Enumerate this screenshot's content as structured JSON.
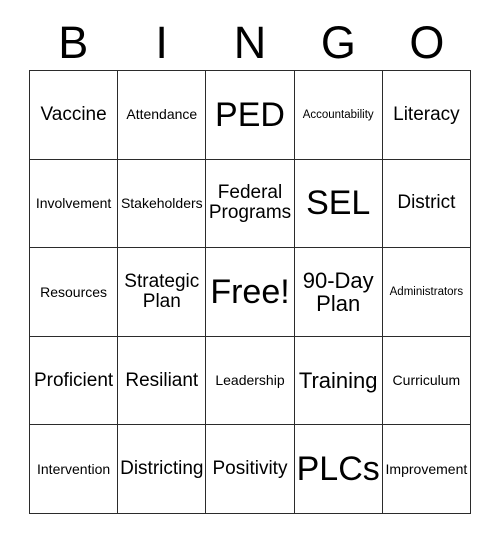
{
  "card": {
    "header_letters": [
      "B",
      "I",
      "N",
      "G",
      "O"
    ],
    "free_space_label": "Free!",
    "rows": [
      [
        {
          "label": "Vaccine",
          "size": "md"
        },
        {
          "label": "Attendance",
          "size": "sm"
        },
        {
          "label": "PED",
          "size": "xxl"
        },
        {
          "label": "Accountability",
          "size": "xs"
        },
        {
          "label": "Literacy",
          "size": "md"
        }
      ],
      [
        {
          "label": "Involvement",
          "size": "sm"
        },
        {
          "label": "Stakeholders",
          "size": "sm"
        },
        {
          "label": "Federal\nPrograms",
          "size": "md"
        },
        {
          "label": "SEL",
          "size": "xxl"
        },
        {
          "label": "District",
          "size": "md"
        }
      ],
      [
        {
          "label": "Resources",
          "size": "sm"
        },
        {
          "label": "Strategic\nPlan",
          "size": "md"
        },
        {
          "label": "Free!",
          "size": "xxl"
        },
        {
          "label": "90-Day\nPlan",
          "size": "lg"
        },
        {
          "label": "Administrators",
          "size": "xs"
        }
      ],
      [
        {
          "label": "Proficient",
          "size": "md"
        },
        {
          "label": "Resiliant",
          "size": "md"
        },
        {
          "label": "Leadership",
          "size": "sm"
        },
        {
          "label": "Training",
          "size": "lg"
        },
        {
          "label": "Curriculum",
          "size": "sm"
        }
      ],
      [
        {
          "label": "Intervention",
          "size": "sm"
        },
        {
          "label": "Districting",
          "size": "md"
        },
        {
          "label": "Positivity",
          "size": "md"
        },
        {
          "label": "PLCs",
          "size": "xxl"
        },
        {
          "label": "Improvement",
          "size": "sm"
        }
      ]
    ]
  },
  "colors": {
    "background": "#ffffff",
    "border": "#2b2b2b",
    "text": "#000000"
  }
}
